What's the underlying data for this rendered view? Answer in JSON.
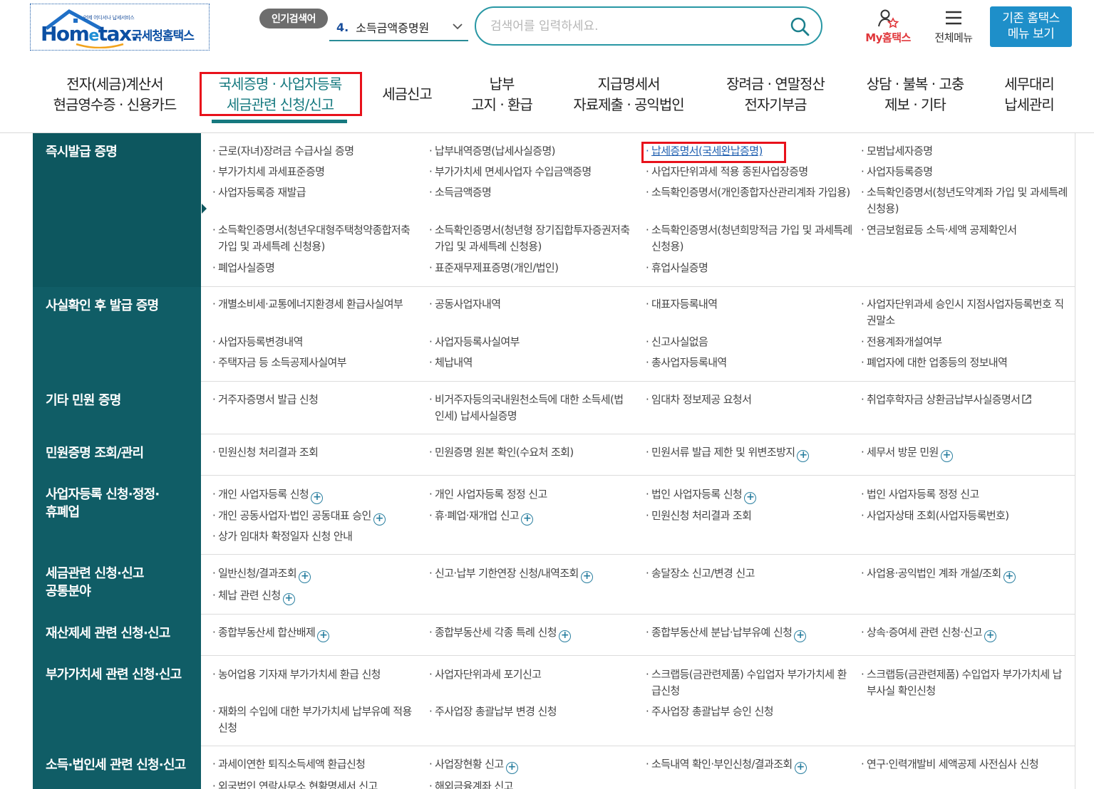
{
  "header": {
    "logo_small": "언제 어디서나 납세서비스",
    "logo_main_a": "Hom",
    "logo_main_e": "e",
    "logo_main_b": "tax.",
    "logo_kor": "국세청홈택스",
    "popular_label": "인기검색어",
    "popular_num": "4.",
    "popular_term": "소득금액증명원",
    "search_placeholder": "검색어를 입력하세요.",
    "my_label": "My홈택스",
    "allmenu_label": "전체메뉴",
    "old_home_line1": "기존 홈택스",
    "old_home_line2": "메뉴 보기"
  },
  "gnb": [
    {
      "l1": "전자(세금)계산서",
      "l2": "현금영수증 · 신용카드"
    },
    {
      "l1": "국세증명 · 사업자등록",
      "l2": "세금관련 신청/신고"
    },
    {
      "l1": "세금신고",
      "l2": ""
    },
    {
      "l1": "납부",
      "l2": "고지 · 환급"
    },
    {
      "l1": "지급명세서",
      "l2": "자료제출 · 공익법인"
    },
    {
      "l1": "장려금 · 연말정산",
      "l2": "전자기부금"
    },
    {
      "l1": "상담 · 불복 · 고충",
      "l2": "제보 · 기타"
    },
    {
      "l1": "세무대리",
      "l2": "납세관리"
    }
  ],
  "categories": [
    "즉시발급 증명",
    "사실확인 후 발급 증명",
    "기타 민원 증명",
    "민원증명 조회/관리",
    "사업자등록 신청·정정·\n휴폐업",
    "세금관련 신청·신고\n공통분야",
    "재산제세 관련 신청·신고",
    "부가가치세 관련 신청·신고",
    "소득·법인세 관련 신청·신고"
  ],
  "items": {
    "r1": [
      "근로(자녀)장려금 수급사실 증명",
      "납부내역증명(납세사실증명)",
      "납세증명서(국세완납증명)",
      "모범납세자증명",
      "부가가치세 과세표준증명",
      "부가가치세 면세사업자 수입금액증명",
      "사업자단위과세 적용 종된사업장증명",
      "사업자등록증명",
      "사업자등록증 재발급",
      "소득금액증명",
      "소득확인증명서(개인종합자산관리계좌 가입용)",
      "소득확인증명서(청년도약계좌 가입 및 과세특례 신청용)",
      "소득확인증명서(청년우대형주택청약종합저축 가입 및 과세특례 신청용)",
      "소득확인증명서(청년형 장기집합투자증권저축 가입 및 과세특례 신청용)",
      "소득확인증명서(청년희망적금 가입 및 과세특례 신청용)",
      "연금보험료등 소득·세액 공제확인서",
      "폐업사실증명",
      "표준재무제표증명(개인/법인)",
      "휴업사실증명"
    ],
    "r2": [
      "개별소비세·교통에너지환경세 환급사실여부",
      "공동사업자내역",
      "대표자등록내역",
      "사업자단위과세 승인시 지점사업자등록번호 직권말소",
      "사업자등록변경내역",
      "사업자등록사실여부",
      "신고사실없음",
      "전용계좌개설여부",
      "주택자금 등 소득공제사실여부",
      "체납내역",
      "총사업자등록내역",
      "폐업자에 대한 업종등의 정보내역"
    ],
    "r3": [
      "거주자증명서 발급 신청",
      "비거주자등의국내원천소득에 대한 소득세(법인세) 납세사실증명",
      "임대차 정보제공 요청서",
      "취업후학자금 상환금납부사실증명서"
    ],
    "r4": [
      "민원신청 처리결과 조회",
      "민원증명 원본 확인(수요처 조회)",
      "민원서류 발급 제한 및 위변조방지",
      "세무서 방문 민원"
    ],
    "r5": [
      "개인 사업자등록 신청",
      "개인 사업자등록 정정 신고",
      "법인 사업자등록 신청",
      "법인 사업자등록 정정 신고",
      "개인 공동사업자·법인 공동대표 승인",
      "휴·폐업·재개업 신고",
      "민원신청 처리결과 조회",
      "사업자상태 조회(사업자등록번호)",
      "상가 임대차 확정일자 신청 안내"
    ],
    "r6": [
      "일반신청/결과조회",
      "신고·납부 기한연장 신청/내역조회",
      "송달장소 신고/변경 신고",
      "사업용·공익법인 계좌 개설/조회",
      "체납 관련 신청"
    ],
    "r7": [
      "종합부동산세 합산배제",
      "종합부동산세 각종 특례 신청",
      "종합부동산세 분납·납부유예 신청",
      "상속·증여세 관련 신청·신고"
    ],
    "r8": [
      "농어업용 기자재 부가가치세 환급 신청",
      "사업자단위과세 포기신고",
      "스크랩등(금관련제품) 수입업자 부가가치세 환급신청",
      "스크랩등(금관련제품) 수입업자 부가가치세 납부사실 확인신청",
      "재화의 수입에 대한 부가가치세 납부유예 적용 신청",
      "주사업장 총괄납부 변경 신청",
      "주사업장 총괄납부 승인 신청"
    ],
    "r9": [
      "과세이연한 퇴직소득세액 환급신청",
      "사업장현황 신고",
      "소득내역 확인·부인신청/결과조회",
      "연구·인력개발비 세액공제 사전심사 신청",
      "외국법인 연락사무소 현황명세서 신고",
      "해외금융계좌 신고"
    ]
  },
  "colors": {
    "category_bg": "#105d66",
    "accent_teal": "#16797f",
    "highlight_red": "#e8111b",
    "link_blue": "#1f5fb0",
    "old_home_bg": "#1e8fc9",
    "my_red": "#e0363a"
  }
}
